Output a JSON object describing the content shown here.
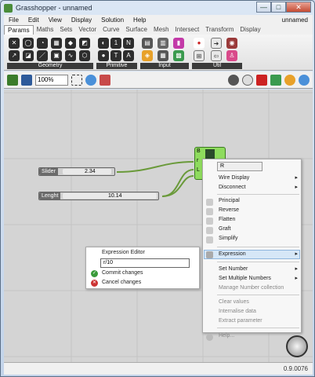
{
  "window": {
    "title": "Grasshopper - unnamed",
    "btn_min": "—",
    "btn_max": "□",
    "btn_close": "✕"
  },
  "menu": {
    "items": [
      "File",
      "Edit",
      "View",
      "Display",
      "Solution",
      "Help"
    ],
    "document_name": "unnamed"
  },
  "tabs": [
    "Params",
    "Maths",
    "Sets",
    "Vector",
    "Curve",
    "Surface",
    "Mesh",
    "Intersect",
    "Transform",
    "Display"
  ],
  "ribbon_groups": [
    "Geometry",
    "Primitive",
    "Input",
    "Util"
  ],
  "toolbar": {
    "zoom": "100%"
  },
  "canvas": {
    "slider1": {
      "label": "Slider",
      "value": "2.34"
    },
    "slider2": {
      "label": "Lenght",
      "value": "10.14"
    },
    "node_inputs": [
      "B",
      "r",
      "L"
    ]
  },
  "context_menu": {
    "name_field": "R",
    "items": [
      "Wire Display",
      "Disconnect",
      "Principal",
      "Reverse",
      "Flatten",
      "Graft",
      "Simplify",
      "Expression",
      "Set Number",
      "Set Multiple Numbers",
      "Manage Number collection",
      "Clear values",
      "Internalise data",
      "Extract parameter",
      "Help..."
    ]
  },
  "expression_editor": {
    "title": "Expression Editor",
    "value": "r/10",
    "commit": "Commit changes",
    "cancel": "Cancel changes"
  },
  "status": {
    "version": "0.9.0076"
  }
}
